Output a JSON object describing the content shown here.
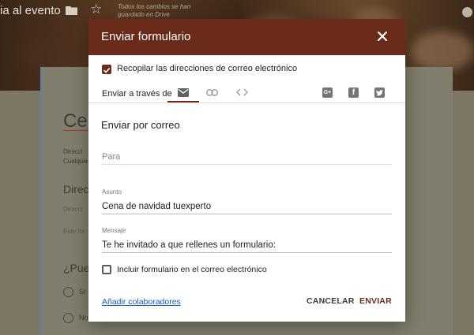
{
  "background": {
    "form_title_fragment": "ia al evento",
    "saved_status": "Todos los cambios se han guardado en Drive",
    "title_fragment": "Cer",
    "address_line1": "Direcci",
    "address_line2": "Cualquie",
    "question1": "Direcc",
    "answer_hint1": "Direcci",
    "answer_hint2": "Este for",
    "question2": "¿Pued",
    "option_yes": "Sí",
    "option_no": "No"
  },
  "dialog": {
    "title": "Enviar formulario",
    "collect_emails_label": "Recopilar las direcciones de correo electrónico",
    "collect_emails_checked": true,
    "send_via_label": "Enviar a través de",
    "tabs": [
      {
        "icon": "email-icon",
        "selected": true
      },
      {
        "icon": "link-icon",
        "selected": false
      },
      {
        "icon": "embed-icon",
        "selected": false
      }
    ],
    "social": [
      "google-plus-icon",
      "facebook-icon",
      "twitter-icon"
    ],
    "section_title": "Enviar por correo",
    "to_placeholder": "Para",
    "subject_label": "Asunto",
    "subject_value": "Cena de navidad tuexperto",
    "message_label": "Mensaje",
    "message_value": "Te he invitado a que rellenes un formulario:",
    "include_form_label": "Incluir formulario en el correo electrónico",
    "include_form_checked": false,
    "add_collaborators": "Añadir colaboradores",
    "cancel_label": "CANCELAR",
    "send_label": "ENVIAR"
  },
  "colors": {
    "accent": "#6a2b1a",
    "link": "#1a57c7"
  }
}
